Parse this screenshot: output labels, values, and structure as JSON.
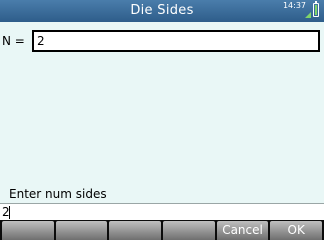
{
  "header": {
    "title": "Die Sides",
    "clock": "14:37"
  },
  "form": {
    "field_label": "N =",
    "field_value": "2"
  },
  "status": {
    "help_text": "Enter num sides",
    "entry_value": "2"
  },
  "softkeys": [
    "",
    "",
    "",
    "",
    "Cancel",
    "OK"
  ]
}
